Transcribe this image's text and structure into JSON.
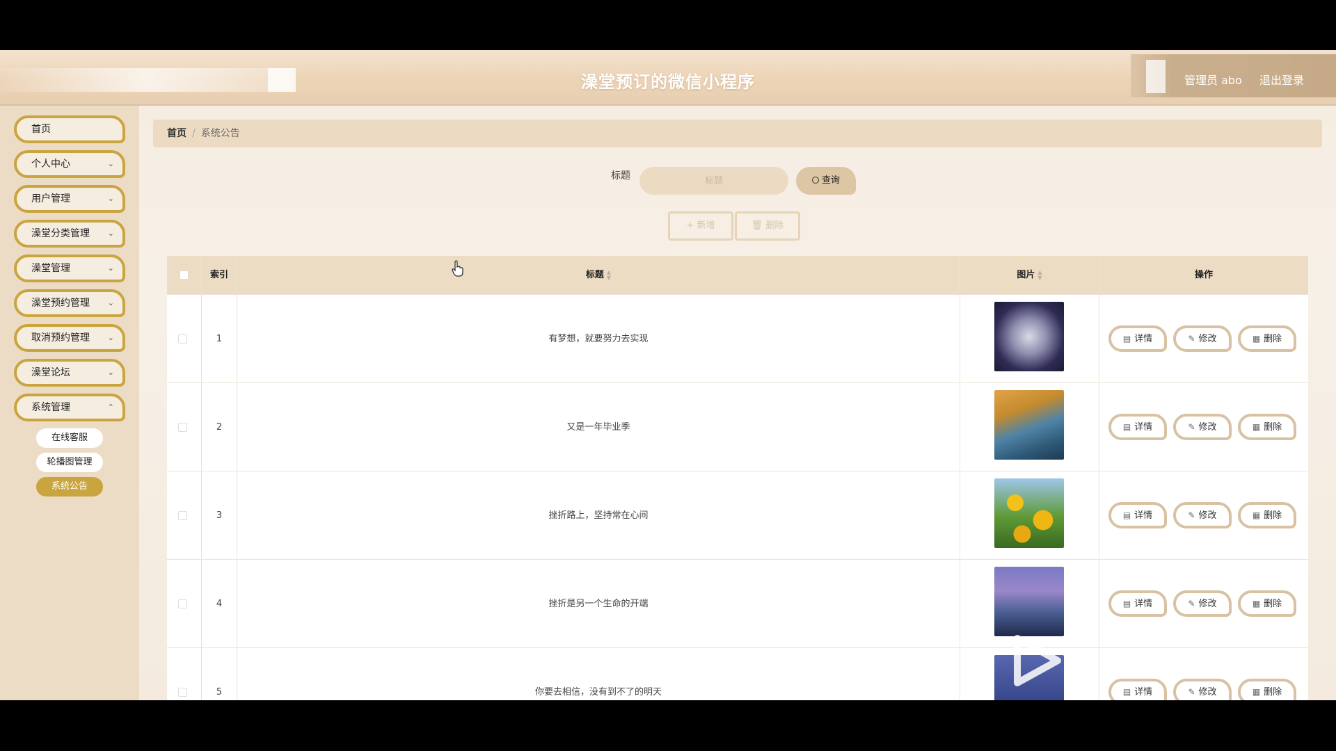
{
  "header": {
    "app_title": "澡堂预订的微信小程序",
    "user_label": "管理员 abo",
    "logout_label": "退出登录"
  },
  "sidebar": {
    "items": [
      {
        "label": "首页",
        "has_chevron": false
      },
      {
        "label": "个人中心",
        "has_chevron": true
      },
      {
        "label": "用户管理",
        "has_chevron": true
      },
      {
        "label": "澡堂分类管理",
        "has_chevron": true
      },
      {
        "label": "澡堂管理",
        "has_chevron": true
      },
      {
        "label": "澡堂预约管理",
        "has_chevron": true
      },
      {
        "label": "取消预约管理",
        "has_chevron": true
      },
      {
        "label": "澡堂论坛",
        "has_chevron": true
      },
      {
        "label": "系统管理",
        "has_chevron": true
      }
    ],
    "sub_items": [
      {
        "label": "在线客服",
        "active": false
      },
      {
        "label": "轮播图管理",
        "active": false
      },
      {
        "label": "系统公告",
        "active": true
      }
    ]
  },
  "breadcrumb": {
    "home": "首页",
    "separator": "/",
    "current": "系统公告"
  },
  "search": {
    "label": "标题",
    "placeholder": "标题",
    "button_label": "查询",
    "button_icon": "search-icon"
  },
  "toolbar": {
    "add_label": "新增",
    "add_icon": "plus-icon",
    "delete_label": "删除",
    "delete_icon": "trash-icon"
  },
  "table": {
    "columns": {
      "index": "索引",
      "title": "标题",
      "image": "图片",
      "actions": "操作"
    },
    "rows": [
      {
        "index": "1",
        "title": "有梦想，就要努力去实现"
      },
      {
        "index": "2",
        "title": "又是一年毕业季"
      },
      {
        "index": "3",
        "title": "挫折路上，坚持常在心间"
      },
      {
        "index": "4",
        "title": "挫折是另一个生命的开端"
      },
      {
        "index": "5",
        "title": "你要去相信，没有到不了的明天"
      }
    ],
    "row_actions": {
      "detail": "详情",
      "edit": "修改",
      "delete": "删除"
    }
  },
  "colors": {
    "accent_gold": "#c9a43f",
    "header_bg": "#ecd3b6",
    "sidebar_bg": "#ecdcc5",
    "table_head_bg": "#ecdcc3"
  }
}
